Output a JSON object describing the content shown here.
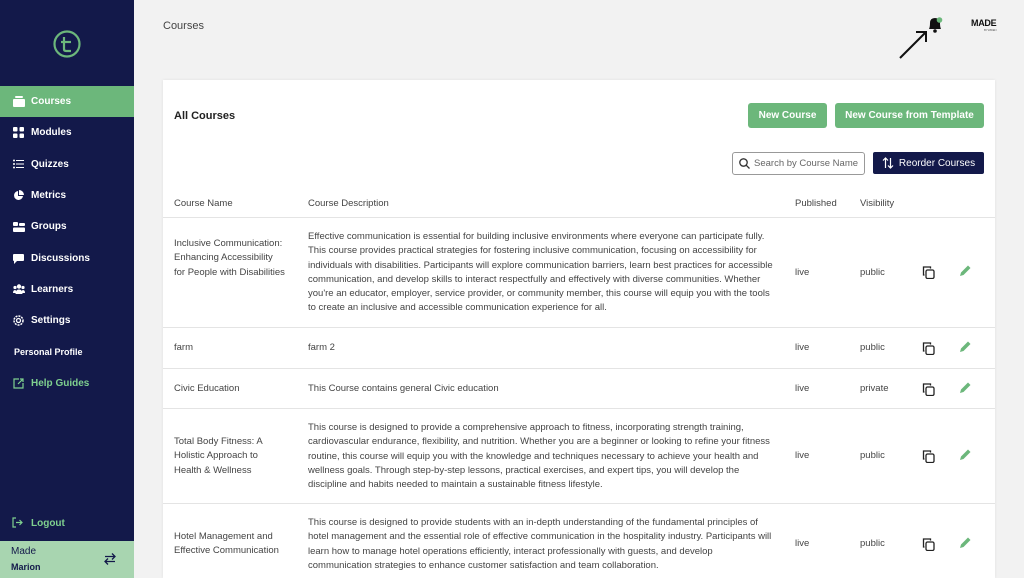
{
  "sidebar": {
    "items": [
      {
        "label": "Courses",
        "icon": "courses-icon"
      },
      {
        "label": "Modules",
        "icon": "modules-icon"
      },
      {
        "label": "Quizzes",
        "icon": "list-icon"
      },
      {
        "label": "Metrics",
        "icon": "pie-chart-icon"
      },
      {
        "label": "Groups",
        "icon": "groups-icon"
      },
      {
        "label": "Discussions",
        "icon": "chat-icon"
      },
      {
        "label": "Learners",
        "icon": "people-icon"
      },
      {
        "label": "Settings",
        "icon": "gear-icon"
      }
    ],
    "personal_profile": "Personal Profile",
    "help_guides": "Help Guides",
    "logout": "Logout",
    "org": "Made",
    "user": "Marion"
  },
  "header": {
    "title": "Courses",
    "brand": "MADE",
    "brand_sub": "BY WIDEN"
  },
  "card": {
    "title": "All Courses",
    "new_course": "New Course",
    "new_from_template": "New Course from Template",
    "search_placeholder": "Search by Course Name",
    "reorder": "Reorder Courses"
  },
  "table": {
    "headers": {
      "name": "Course Name",
      "description": "Course Description",
      "published": "Published",
      "visibility": "Visibility"
    },
    "rows": [
      {
        "name": "Inclusive Communication: Enhancing Accessibility for People with Disabilities",
        "description": "Effective communication is essential for building inclusive environments where everyone can participate fully. This course provides practical strategies for fostering inclusive communication, focusing on accessibility for individuals with disabilities. Participants will explore communication barriers, learn best practices for accessible communication, and develop skills to interact respectfully and effectively with diverse communities. Whether you're an educator, employer, service provider, or community member, this course will equip you with the tools to create an inclusive and accessible communication experience for all.",
        "published": "live",
        "visibility": "public"
      },
      {
        "name": "farm",
        "description": "farm 2",
        "published": "live",
        "visibility": "public"
      },
      {
        "name": "Civic Education",
        "description": "This Course contains general Civic education",
        "published": "live",
        "visibility": "private"
      },
      {
        "name": "Total Body Fitness: A Holistic Approach to Health & Wellness",
        "description": "This course is designed to provide a comprehensive approach to fitness, incorporating strength training, cardiovascular endurance, flexibility, and nutrition. Whether you are a beginner or looking to refine your fitness routine, this course will equip you with the knowledge and techniques necessary to achieve your health and wellness goals. Through step-by-step lessons, practical exercises, and expert tips, you will develop the discipline and habits needed to maintain a sustainable fitness lifestyle.",
        "published": "live",
        "visibility": "public"
      },
      {
        "name": "Hotel Management and Effective Communication",
        "description": "This course is designed to provide students with an in-depth understanding of the fundamental principles of hotel management and the essential role of effective communication in the hospitality industry. Participants will learn how to manage hotel operations efficiently, interact professionally with guests, and develop communication strategies to enhance customer satisfaction and team collaboration.",
        "published": "live",
        "visibility": "public"
      }
    ]
  },
  "colors": {
    "sidebar_bg": "#13194a",
    "accent_green": "#6cb77b",
    "user_box_bg": "#a8d5b0"
  }
}
